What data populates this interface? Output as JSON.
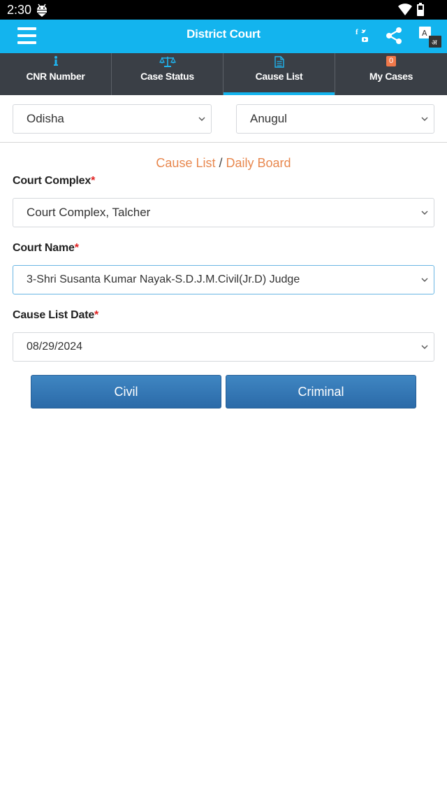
{
  "status_bar": {
    "time": "2:30"
  },
  "app_bar": {
    "title": "District Court",
    "icons": [
      "menu-icon",
      "social-icon",
      "share-icon",
      "translate-icon"
    ]
  },
  "tabs": [
    {
      "label": "CNR Number",
      "icon": "info-icon"
    },
    {
      "label": "Case Status",
      "icon": "scale-icon"
    },
    {
      "label": "Cause List",
      "icon": "document-icon",
      "active": true
    },
    {
      "label": "My Cases",
      "badge": "0"
    }
  ],
  "location": {
    "state": "Odisha",
    "district": "Anugul"
  },
  "heading": {
    "part1": "Cause List",
    "separator": "/",
    "part2": "Daily Board"
  },
  "form": {
    "court_complex": {
      "label": "Court Complex",
      "required": "*",
      "value": "Court Complex, Talcher"
    },
    "court_name": {
      "label": "Court Name",
      "required": "*",
      "value": "3-Shri Susanta Kumar Nayak-S.D.J.M.Civil(Jr.D) Judge"
    },
    "cause_list_date": {
      "label": "Cause List Date",
      "required": "*",
      "value": "08/29/2024"
    }
  },
  "buttons": {
    "civil": "Civil",
    "criminal": "Criminal"
  },
  "colors": {
    "primary": "#13b4ee",
    "tab_bar": "#3a3f46",
    "accent_orange": "#e8884f",
    "button": "#2f72b0",
    "required": "#e12020"
  }
}
